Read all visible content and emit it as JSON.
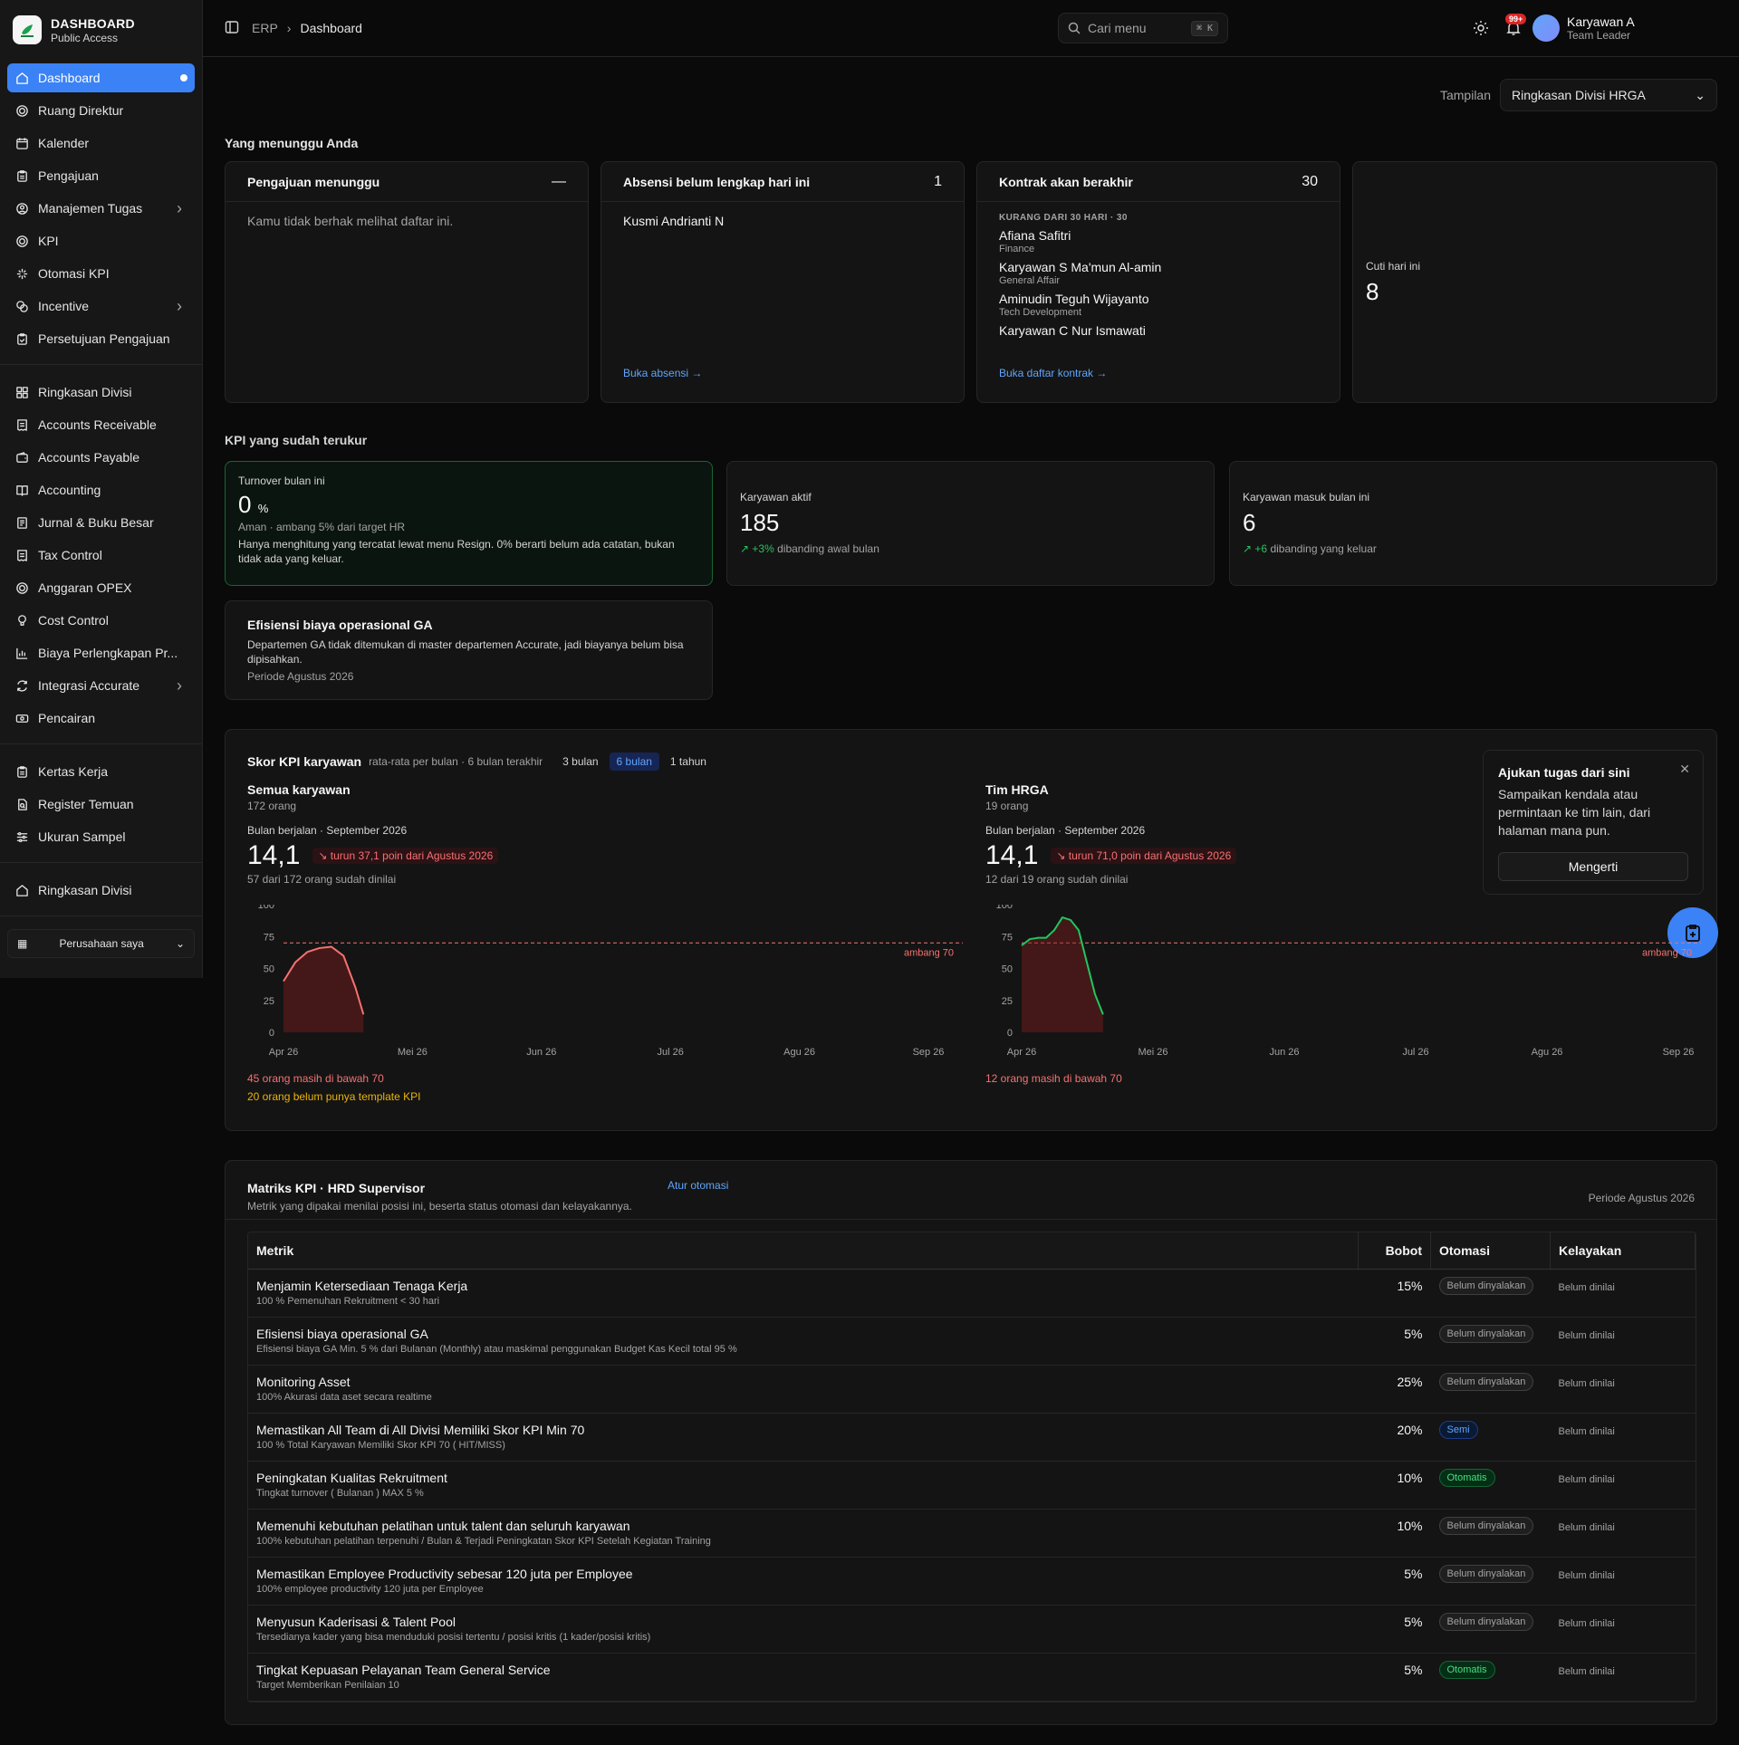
{
  "brand": {
    "title": "DASHBOARD",
    "subtitle": "Public Access"
  },
  "nav_primary": [
    {
      "label": "Dashboard",
      "icon": "home-icon",
      "active": true
    },
    {
      "label": "Ruang Direktur",
      "icon": "target-icon"
    },
    {
      "label": "Kalender",
      "icon": "calendar-icon"
    },
    {
      "label": "Pengajuan",
      "icon": "clipboard-icon"
    },
    {
      "label": "Manajemen Tugas",
      "icon": "users-icon",
      "chevron": true
    },
    {
      "label": "KPI",
      "icon": "target-icon"
    },
    {
      "label": "Otomasi KPI",
      "icon": "sparkle-icon"
    },
    {
      "label": "Incentive",
      "icon": "coins-icon",
      "chevron": true
    },
    {
      "label": "Persetujuan Pengajuan",
      "icon": "clipboard-check-icon"
    }
  ],
  "nav_finance": [
    {
      "label": "Ringkasan Divisi",
      "icon": "grid-icon"
    },
    {
      "label": "Accounts Receivable",
      "icon": "receipt-icon"
    },
    {
      "label": "Accounts Payable",
      "icon": "wallet-icon"
    },
    {
      "label": "Accounting",
      "icon": "book-icon"
    },
    {
      "label": "Jurnal & Buku Besar",
      "icon": "ledger-icon"
    },
    {
      "label": "Tax Control",
      "icon": "receipt-icon"
    },
    {
      "label": "Anggaran OPEX",
      "icon": "target-icon"
    },
    {
      "label": "Cost Control",
      "icon": "bulb-icon"
    },
    {
      "label": "Biaya Perlengkapan Pr...",
      "icon": "chart-icon"
    },
    {
      "label": "Integrasi Accurate",
      "icon": "refresh-icon",
      "chevron": true
    },
    {
      "label": "Pencairan",
      "icon": "cash-icon"
    }
  ],
  "nav_audit": [
    {
      "label": "Kertas Kerja",
      "icon": "clipboard-icon"
    },
    {
      "label": "Register Temuan",
      "icon": "file-search-icon"
    },
    {
      "label": "Ukuran Sampel",
      "icon": "sliders-icon"
    }
  ],
  "nav_bottom": [
    {
      "label": "Ringkasan Divisi",
      "icon": "home-icon"
    }
  ],
  "company_selector": "Perusahaan saya",
  "breadcrumb": {
    "root": "ERP",
    "current": "Dashboard"
  },
  "search": {
    "placeholder": "Cari menu",
    "shortcut": "⌘ K"
  },
  "notifications": {
    "badge": "99+"
  },
  "user": {
    "name": "Karyawan A",
    "role": "Team Leader"
  },
  "view": {
    "label": "Tampilan",
    "selected": "Ringkasan Divisi HRGA"
  },
  "waiting": {
    "title": "Yang menunggu Anda",
    "pengajuan": {
      "title": "Pengajuan menunggu",
      "count": "—",
      "message": "Kamu tidak berhak melihat daftar ini."
    },
    "absensi": {
      "title": "Absensi belum lengkap hari ini",
      "count": "1",
      "name": "Kusmi Andrianti N",
      "link": "Buka absensi →"
    },
    "kontrak": {
      "title": "Kontrak akan berakhir",
      "count": "30",
      "group_label": "KURANG DARI 30 HARI · 30",
      "people": [
        {
          "name": "Afiana Safitri",
          "dept": "Finance"
        },
        {
          "name": "Karyawan S Ma'mun Al-amin",
          "dept": "General Affair"
        },
        {
          "name": "Aminudin Teguh Wijayanto",
          "dept": "Tech Development"
        },
        {
          "name": "Karyawan C Nur Ismawati",
          "dept": ""
        }
      ],
      "link": "Buka daftar kontrak →"
    },
    "cuti": {
      "label": "Cuti hari ini",
      "value": "8"
    }
  },
  "kpi_measured": {
    "title": "KPI yang sudah terukur",
    "turnover": {
      "label": "Turnover bulan ini",
      "value": "0",
      "unit": "%",
      "note1": "Aman · ambang 5% dari target HR",
      "note2": "Hanya menghitung yang tercatat lewat menu Resign. 0% berarti belum ada catatan, bukan tidak ada yang keluar."
    },
    "aktif": {
      "label": "Karyawan aktif",
      "value": "185",
      "delta": "+3%",
      "delta_text": "dibanding awal bulan"
    },
    "masuk": {
      "label": "Karyawan masuk bulan ini",
      "value": "6",
      "delta": "+6",
      "delta_text": "dibanding yang keluar"
    },
    "efisiensi": {
      "title": "Efisiensi biaya operasional GA",
      "text": "Departemen GA tidak ditemukan di master departemen Accurate, jadi biayanya belum bisa dipisahkan.",
      "period": "Periode Agustus 2026"
    }
  },
  "skor": {
    "title": "Skor KPI karyawan",
    "subtitle": "rata-rata per bulan · 6 bulan terakhir",
    "ranges": [
      "3 bulan",
      "6 bulan",
      "1 tahun"
    ],
    "active_range": "6 bulan",
    "panels": [
      {
        "title": "Semua karyawan",
        "count": "172 orang",
        "period": "Bulan berjalan · September 2026",
        "score": "14,1",
        "trend": "turun 37,1 poin dari Agustus 2026",
        "assessed": "57 dari 172 orang sudah dinilai",
        "notes": [
          {
            "text": "45 orang masih di bawah 70",
            "tone": "red"
          },
          {
            "text": "20 orang belum punya template KPI",
            "tone": "amber"
          }
        ]
      },
      {
        "title": "Tim HRGA",
        "count": "19 orang",
        "period": "Bulan berjalan · September 2026",
        "score": "14,1",
        "trend": "turun 71,0 poin dari Agustus 2026",
        "assessed": "12 dari 19 orang sudah dinilai",
        "notes": [
          {
            "text": "12 orang masih di bawah 70",
            "tone": "red"
          }
        ]
      }
    ],
    "popover": {
      "title": "Ajukan tugas dari sini",
      "text": "Sampaikan kendala atau permintaan ke tim lain, dari halaman mana pun.",
      "button": "Mengerti"
    }
  },
  "chart_data": [
    {
      "type": "line",
      "title": "Semua karyawan",
      "x": [
        "Apr 26",
        "Mei 26",
        "Jun 26",
        "Jul 26",
        "Agu 26",
        "Sep 26"
      ],
      "ylim": [
        0,
        100
      ],
      "yticks": [
        0,
        25,
        50,
        75,
        100
      ],
      "threshold": {
        "value": 70,
        "label": "ambang 70"
      },
      "series": [
        {
          "x": [
            0,
            0.15,
            0.3,
            0.45,
            0.6,
            0.75,
            0.9,
            1.0
          ],
          "y": [
            40,
            55,
            63,
            66,
            67,
            60,
            35,
            14
          ]
        }
      ],
      "line_color": "#f87171"
    },
    {
      "type": "line",
      "title": "Tim HRGA",
      "x": [
        "Apr 26",
        "Mei 26",
        "Jun 26",
        "Jul 26",
        "Agu 26",
        "Sep 26"
      ],
      "ylim": [
        0,
        100
      ],
      "yticks": [
        0,
        25,
        50,
        75,
        100
      ],
      "threshold": {
        "value": 70,
        "label": "ambang 70"
      },
      "series": [
        {
          "x": [
            0,
            0.1,
            0.2,
            0.3,
            0.4,
            0.5,
            0.6,
            0.7,
            0.8,
            0.9,
            1.0
          ],
          "y": [
            68,
            73,
            74,
            74,
            80,
            90,
            88,
            80,
            55,
            30,
            14
          ]
        }
      ],
      "line_color": "#22c55e"
    }
  ],
  "matriks": {
    "title": "Matriks KPI · HRD Supervisor",
    "link": "Atur otomasi",
    "subtitle": "Metrik yang dipakai menilai posisi ini, beserta status otomasi dan kelayakannya.",
    "period": "Periode Agustus 2026",
    "headers": [
      "Metrik",
      "Bobot",
      "Otomasi",
      "Kelayakan"
    ],
    "rows": [
      {
        "name": "Menjamin Ketersediaan Tenaga Kerja",
        "desc": "100 % Pemenuhan Rekruitment < 30 hari",
        "weight": "15%",
        "status": "Belum dinyalakan",
        "kind": "none",
        "eligibility": "Belum dinilai"
      },
      {
        "name": "Efisiensi biaya operasional GA",
        "desc": "Efisiensi biaya GA Min. 5 % dari Bulanan (Monthly) atau maskimal penggunakan Budget Kas Kecil total 95 %",
        "weight": "5%",
        "status": "Belum dinyalakan",
        "kind": "none",
        "eligibility": "Belum dinilai"
      },
      {
        "name": "Monitoring Asset",
        "desc": "100% Akurasi data aset secara realtime",
        "weight": "25%",
        "status": "Belum dinyalakan",
        "kind": "none",
        "eligibility": "Belum dinilai"
      },
      {
        "name": "Memastikan All Team di All Divisi Memiliki Skor KPI Min 70",
        "desc": "100 % Total Karyawan Memiliki Skor KPI 70 ( HIT/MISS)",
        "weight": "20%",
        "status": "Semi",
        "kind": "semi",
        "eligibility": "Belum dinilai"
      },
      {
        "name": "Peningkatan Kualitas Rekruitment",
        "desc": "Tingkat turnover ( Bulanan ) MAX 5 %",
        "weight": "10%",
        "status": "Otomatis",
        "kind": "otomatis",
        "eligibility": "Belum dinilai"
      },
      {
        "name": "Memenuhi kebutuhan pelatihan untuk talent dan seluruh karyawan",
        "desc": "100% kebutuhan pelatihan terpenuhi / Bulan & Terjadi Peningkatan Skor KPI Setelah Kegiatan Training",
        "weight": "10%",
        "status": "Belum dinyalakan",
        "kind": "none",
        "eligibility": "Belum dinilai"
      },
      {
        "name": "Memastikan Employee Productivity sebesar 120 juta per Employee",
        "desc": "100% employee productivity 120 juta per Employee",
        "weight": "5%",
        "status": "Belum dinyalakan",
        "kind": "none",
        "eligibility": "Belum dinilai"
      },
      {
        "name": "Menyusun Kaderisasi & Talent Pool",
        "desc": "Tersedianya kader yang bisa menduduki posisi tertentu / posisi kritis (1 kader/posisi kritis)",
        "weight": "5%",
        "status": "Belum dinyalakan",
        "kind": "none",
        "eligibility": "Belum dinilai"
      },
      {
        "name": "Tingkat Kepuasan Pelayanan Team General Service",
        "desc": "Target Memberikan Penilaian 10",
        "weight": "5%",
        "status": "Otomatis",
        "kind": "otomatis",
        "eligibility": "Belum dinilai"
      }
    ]
  }
}
